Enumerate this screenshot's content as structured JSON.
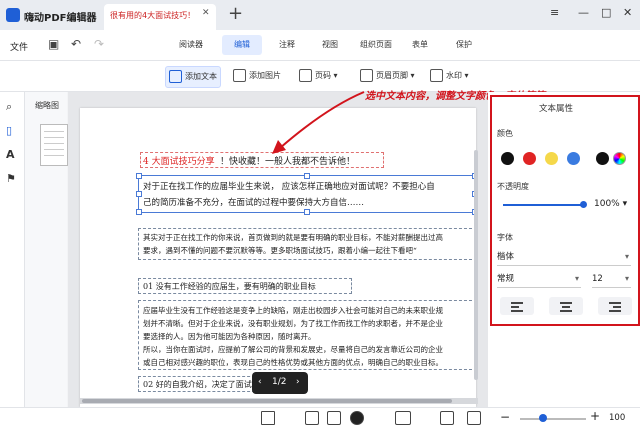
{
  "app": {
    "name": "嗨动PDF编辑器",
    "tab_title": "很有用的4大面试技巧！"
  },
  "menu": {
    "file": "文件",
    "tabs": [
      "阅读器",
      "编辑",
      "注释",
      "视图",
      "组织页面",
      "表单",
      "保护"
    ],
    "active_tab": "编辑"
  },
  "edit_tools": {
    "add_text": "添加文本",
    "add_image": "添加图片",
    "page_number": "页码",
    "header_footer": "页眉页脚",
    "watermark": "水印"
  },
  "sidebar": {
    "thumbnail_label": "缩略图"
  },
  "annotation": {
    "text": "选中文本内容，调整文字颜色、字体等等",
    "color": "#d2141c"
  },
  "document": {
    "heading_red": "4 大面试技巧分享",
    "heading_black": "！快收藏！一般人我都不告诉他！",
    "selected_line1": "对于正在找工作的应届毕业生来说，  应该怎样正确地应对面试呢？不要担心自",
    "selected_line2": "己的简历准备不充分，在面试的过程中要保持大方自信……",
    "para1_line1": "其实对于正在找工作的你来说，首页做到的就是要有明确的职业目标，不能对薪酬提出过高",
    "para1_line2": "要求，遇到不懂的问题不要沉默等等。更多职场面试技巧，跟着小编一起往下看吧“",
    "section1": "01 没有工作经验的应届生，要有明确的职业目标",
    "para2_lines": [
      "应届毕业生没有工作经验这是变争上的缺陷，刚走出校园步入社会可能对自己的未来职业规",
      "划并不清晰。但对于企业来说，没有职业规划，为了找工作而找工作的求职者，并不是企业",
      "要选择的人。因为他可能因为各种原因，随时离开。",
      "所以，当你在面试时，应提前了解公司的背景和发展史，尽量将自己的发言靠近公司的企业",
      "或自己相对感兴趣的职位，表现自己的性格优势或其他方面的优点，明确自己的职业目标。"
    ],
    "section2": "02 好的自我介绍，决定了面试的好坏"
  },
  "pager": {
    "current": "1/2"
  },
  "text_props": {
    "title": "文本属性",
    "color_label": "颜色",
    "colors": [
      "#111111",
      "#e02424",
      "#f5d84a",
      "#3a7be0",
      "#111111"
    ],
    "opacity_label": "不透明度",
    "opacity_value": "100%",
    "opacity": 1.0,
    "font_label": "字体",
    "font_family": "楷体",
    "font_style": "常规",
    "font_size": "12"
  },
  "status": {
    "zoom": "100",
    "zoom_level": 0.35
  }
}
